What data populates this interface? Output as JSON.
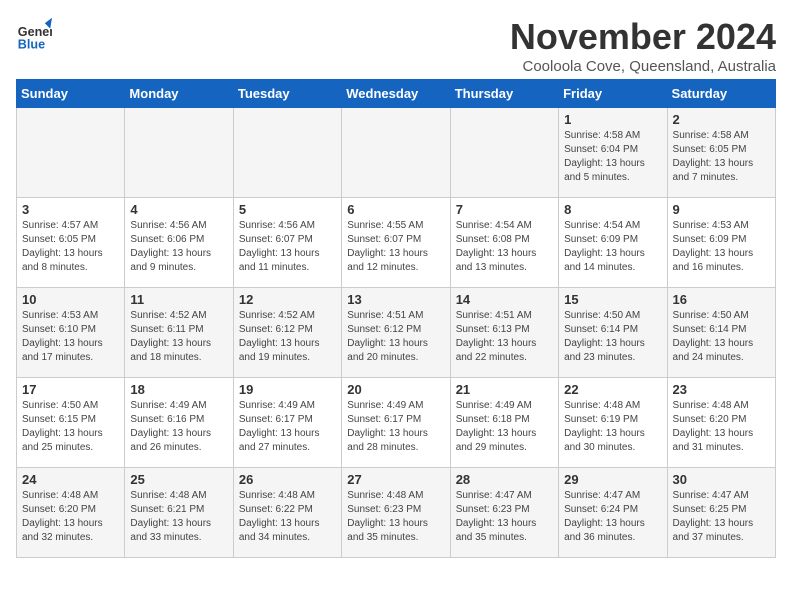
{
  "logo": {
    "line1": "General",
    "line2": "Blue"
  },
  "title": "November 2024",
  "location": "Cooloola Cove, Queensland, Australia",
  "days_of_week": [
    "Sunday",
    "Monday",
    "Tuesday",
    "Wednesday",
    "Thursday",
    "Friday",
    "Saturday"
  ],
  "weeks": [
    [
      {
        "day": "",
        "info": ""
      },
      {
        "day": "",
        "info": ""
      },
      {
        "day": "",
        "info": ""
      },
      {
        "day": "",
        "info": ""
      },
      {
        "day": "",
        "info": ""
      },
      {
        "day": "1",
        "info": "Sunrise: 4:58 AM\nSunset: 6:04 PM\nDaylight: 13 hours and 5 minutes."
      },
      {
        "day": "2",
        "info": "Sunrise: 4:58 AM\nSunset: 6:05 PM\nDaylight: 13 hours and 7 minutes."
      }
    ],
    [
      {
        "day": "3",
        "info": "Sunrise: 4:57 AM\nSunset: 6:05 PM\nDaylight: 13 hours and 8 minutes."
      },
      {
        "day": "4",
        "info": "Sunrise: 4:56 AM\nSunset: 6:06 PM\nDaylight: 13 hours and 9 minutes."
      },
      {
        "day": "5",
        "info": "Sunrise: 4:56 AM\nSunset: 6:07 PM\nDaylight: 13 hours and 11 minutes."
      },
      {
        "day": "6",
        "info": "Sunrise: 4:55 AM\nSunset: 6:07 PM\nDaylight: 13 hours and 12 minutes."
      },
      {
        "day": "7",
        "info": "Sunrise: 4:54 AM\nSunset: 6:08 PM\nDaylight: 13 hours and 13 minutes."
      },
      {
        "day": "8",
        "info": "Sunrise: 4:54 AM\nSunset: 6:09 PM\nDaylight: 13 hours and 14 minutes."
      },
      {
        "day": "9",
        "info": "Sunrise: 4:53 AM\nSunset: 6:09 PM\nDaylight: 13 hours and 16 minutes."
      }
    ],
    [
      {
        "day": "10",
        "info": "Sunrise: 4:53 AM\nSunset: 6:10 PM\nDaylight: 13 hours and 17 minutes."
      },
      {
        "day": "11",
        "info": "Sunrise: 4:52 AM\nSunset: 6:11 PM\nDaylight: 13 hours and 18 minutes."
      },
      {
        "day": "12",
        "info": "Sunrise: 4:52 AM\nSunset: 6:12 PM\nDaylight: 13 hours and 19 minutes."
      },
      {
        "day": "13",
        "info": "Sunrise: 4:51 AM\nSunset: 6:12 PM\nDaylight: 13 hours and 20 minutes."
      },
      {
        "day": "14",
        "info": "Sunrise: 4:51 AM\nSunset: 6:13 PM\nDaylight: 13 hours and 22 minutes."
      },
      {
        "day": "15",
        "info": "Sunrise: 4:50 AM\nSunset: 6:14 PM\nDaylight: 13 hours and 23 minutes."
      },
      {
        "day": "16",
        "info": "Sunrise: 4:50 AM\nSunset: 6:14 PM\nDaylight: 13 hours and 24 minutes."
      }
    ],
    [
      {
        "day": "17",
        "info": "Sunrise: 4:50 AM\nSunset: 6:15 PM\nDaylight: 13 hours and 25 minutes."
      },
      {
        "day": "18",
        "info": "Sunrise: 4:49 AM\nSunset: 6:16 PM\nDaylight: 13 hours and 26 minutes."
      },
      {
        "day": "19",
        "info": "Sunrise: 4:49 AM\nSunset: 6:17 PM\nDaylight: 13 hours and 27 minutes."
      },
      {
        "day": "20",
        "info": "Sunrise: 4:49 AM\nSunset: 6:17 PM\nDaylight: 13 hours and 28 minutes."
      },
      {
        "day": "21",
        "info": "Sunrise: 4:49 AM\nSunset: 6:18 PM\nDaylight: 13 hours and 29 minutes."
      },
      {
        "day": "22",
        "info": "Sunrise: 4:48 AM\nSunset: 6:19 PM\nDaylight: 13 hours and 30 minutes."
      },
      {
        "day": "23",
        "info": "Sunrise: 4:48 AM\nSunset: 6:20 PM\nDaylight: 13 hours and 31 minutes."
      }
    ],
    [
      {
        "day": "24",
        "info": "Sunrise: 4:48 AM\nSunset: 6:20 PM\nDaylight: 13 hours and 32 minutes."
      },
      {
        "day": "25",
        "info": "Sunrise: 4:48 AM\nSunset: 6:21 PM\nDaylight: 13 hours and 33 minutes."
      },
      {
        "day": "26",
        "info": "Sunrise: 4:48 AM\nSunset: 6:22 PM\nDaylight: 13 hours and 34 minutes."
      },
      {
        "day": "27",
        "info": "Sunrise: 4:48 AM\nSunset: 6:23 PM\nDaylight: 13 hours and 35 minutes."
      },
      {
        "day": "28",
        "info": "Sunrise: 4:47 AM\nSunset: 6:23 PM\nDaylight: 13 hours and 35 minutes."
      },
      {
        "day": "29",
        "info": "Sunrise: 4:47 AM\nSunset: 6:24 PM\nDaylight: 13 hours and 36 minutes."
      },
      {
        "day": "30",
        "info": "Sunrise: 4:47 AM\nSunset: 6:25 PM\nDaylight: 13 hours and 37 minutes."
      }
    ]
  ]
}
